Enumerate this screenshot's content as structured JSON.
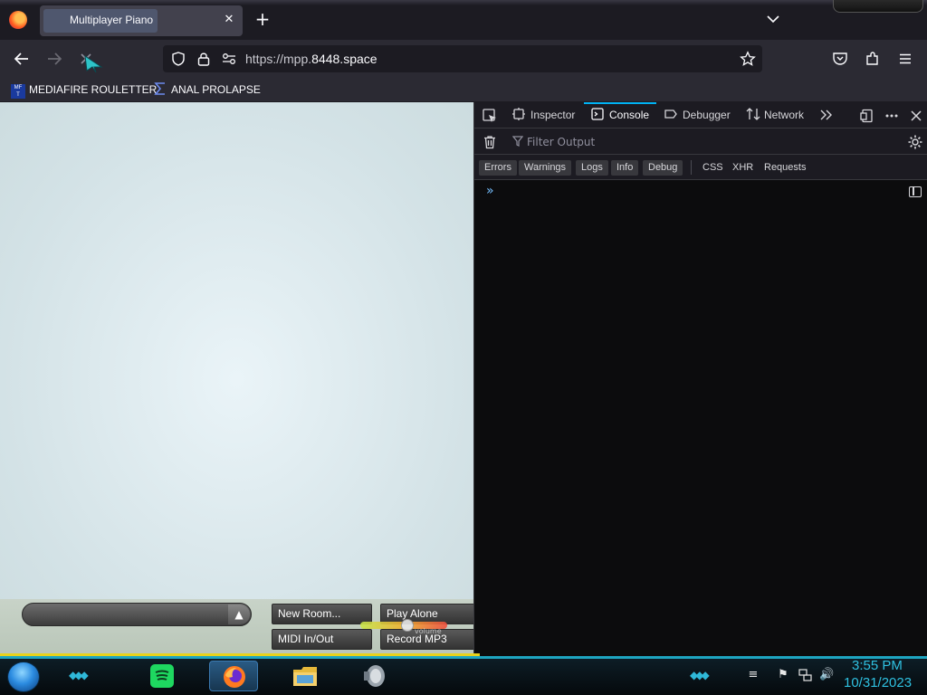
{
  "browser": {
    "tab": {
      "title": "Multiplayer Piano",
      "close_label": "✕"
    },
    "new_tab_label": "+",
    "url": {
      "prefix": "https://mpp.",
      "domain": "8448.space"
    },
    "bookmarks": [
      {
        "label": "MEDIAFIRE ROULETTER",
        "icon": "mediafire-icon"
      },
      {
        "label": "ANAL PROLAPSE",
        "icon": "sigma-icon"
      }
    ]
  },
  "page": {
    "chat_up_label": "▲",
    "buttons": {
      "new_room": "New Room...",
      "play_alone": "Play Alone",
      "midi": "MIDI In/Out",
      "record": "Record MP3"
    },
    "volume": {
      "label": "volume",
      "level": 0.55
    }
  },
  "devtools": {
    "tabs": {
      "inspector": "Inspector",
      "console": "Console",
      "debugger": "Debugger",
      "network": "Network"
    },
    "active_tab": "Console",
    "filter_placeholder": "Filter Output",
    "levels": [
      {
        "label": "Errors",
        "on": true
      },
      {
        "label": "Warnings",
        "on": true
      },
      {
        "label": "Logs",
        "on": true
      },
      {
        "label": "Info",
        "on": true
      },
      {
        "label": "Debug",
        "on": true
      },
      {
        "label": "CSS",
        "on": false
      },
      {
        "label": "XHR",
        "on": false
      },
      {
        "label": "Requests",
        "on": false
      }
    ],
    "prompt_symbol": "»"
  },
  "taskbar": {
    "time": "3:55 PM",
    "date": "10/31/2023",
    "apps": [
      "spotify-icon",
      "firefox-icon",
      "file-explorer-icon",
      "speaker-app-icon"
    ]
  },
  "colors": {
    "accent": "#00b3f4",
    "taskbar_accent": "#1ea5c0",
    "clock": "#2fc0e0"
  }
}
